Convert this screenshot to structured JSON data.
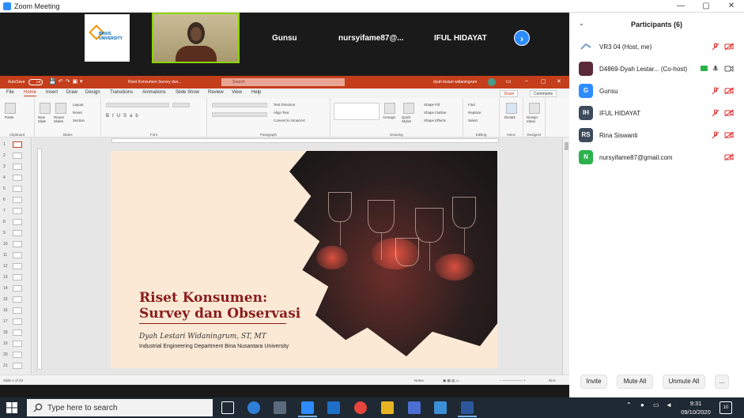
{
  "zoom": {
    "window_title": "Zoom Meeting",
    "window_controls": [
      "—",
      "▢",
      "✕"
    ]
  },
  "video_strip": {
    "logo_text": "BINUS UNIVERSITY",
    "tiles": [
      "Gunsu",
      "nursyifame87@...",
      "IFUL HIDAYAT"
    ],
    "next_label": "›"
  },
  "ppt": {
    "autosave_label": "AutoSave",
    "autosave_state": "Off",
    "doc_title": "Riset Konsumen Survey dan...",
    "search_placeholder": "Search",
    "user_name": "dyah lestari widaningrum",
    "tabs": [
      "File",
      "Home",
      "Insert",
      "Draw",
      "Design",
      "Transitions",
      "Animations",
      "Slide Show",
      "Review",
      "View",
      "Help"
    ],
    "active_tab": "Home",
    "share_label": "Share",
    "comments_label": "Comments",
    "ribbon_groups": [
      "Clipboard",
      "Slides",
      "Font",
      "Paragraph",
      "Drawing",
      "Editing",
      "Voice",
      "Designer"
    ],
    "ribbon_buttons": {
      "paste": "Paste",
      "new_slide": "New Slide",
      "reuse_slides": "Reuse Slides",
      "layout": "Layout",
      "reset": "Reset",
      "section": "Section",
      "text_direction": "Text Direction",
      "align_text": "Align Text",
      "convert_smartart": "Convert to SmartArt",
      "arrange": "Arrange",
      "quick_styles": "Quick Styles",
      "shape_fill": "Shape Fill",
      "shape_outline": "Shape Outline",
      "shape_effects": "Shape Effects",
      "find": "Find",
      "replace": "Replace",
      "select": "Select",
      "dictate": "Dictate",
      "design_ideas": "Design Ideas"
    },
    "slide_numbers": [
      "1",
      "2",
      "3",
      "4",
      "5",
      "6",
      "7",
      "8",
      "9",
      "10",
      "11",
      "12",
      "13",
      "14",
      "15",
      "16",
      "17",
      "18",
      "19",
      "20",
      "21"
    ],
    "slide": {
      "title_line1": "Riset Konsumen:",
      "title_line2": "Survey dan Observasi",
      "author": "Dyah Lestari Widaningrum, ST, MT",
      "department": "Industrial Engineering Department Bina Nusantara University"
    },
    "status": {
      "slide_count": "Slide 1 of 23",
      "notes": "Notes",
      "zoom": "61%"
    }
  },
  "participants": {
    "title": "Participants (6)",
    "list": [
      {
        "name": "VR3 04 (Host, me)",
        "initials": "",
        "color": "#ffffff"
      },
      {
        "name": "D4869-Dyah Lestar... (Co-host)",
        "initials": "",
        "color": "#5a2a3a"
      },
      {
        "name": "Gunsu",
        "initials": "G",
        "color": "#2d8cff"
      },
      {
        "name": "IFUL HIDAYAT",
        "initials": "IH",
        "color": "#3d4b5c"
      },
      {
        "name": "Rina Siswanti",
        "initials": "RS",
        "color": "#3d4b5c"
      },
      {
        "name": "nursyifame87@gmail.com",
        "initials": "N",
        "color": "#2bb24c"
      }
    ],
    "buttons": [
      "Invite",
      "Mute All",
      "Unmute All",
      "..."
    ]
  },
  "taskbar": {
    "search_placeholder": "Type here to search",
    "time": "9:31",
    "date": "09/10/2020",
    "notifications": "10"
  }
}
